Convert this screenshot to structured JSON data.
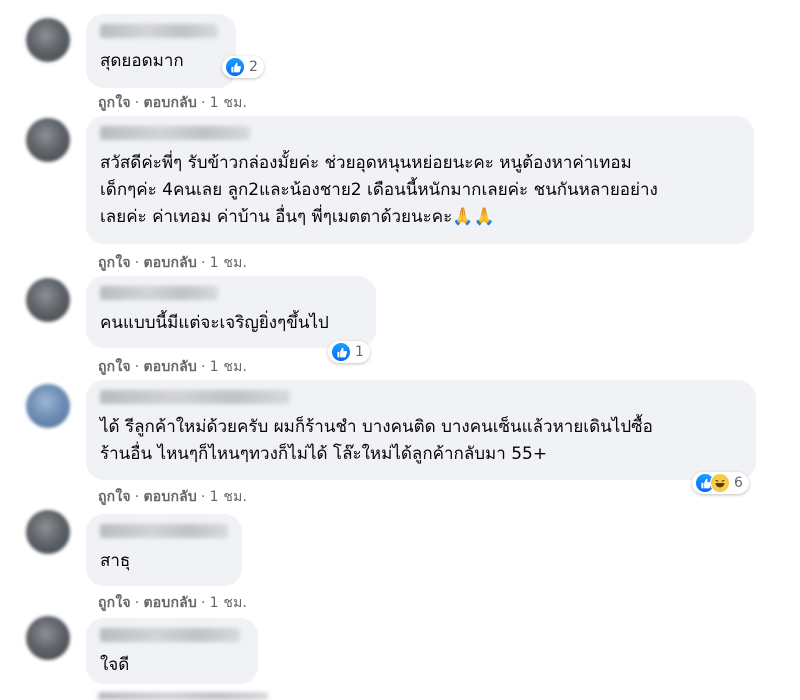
{
  "comments": [
    {
      "text": "สุดยอดมาก",
      "reactions": {
        "types": [
          "like"
        ],
        "count": "2"
      },
      "meta": {
        "like": "ถูกใจ",
        "reply": "ตอบกลับ",
        "time": "1 ชม."
      }
    },
    {
      "text": "สวัสดีค่ะพี่ๆ รับข้าวกล่องมั้ยค่ะ ช่วยอุดหนุนหย่อยนะคะ หนูต้องหาค่าเทอม\nเด็กๆค่ะ 4คนเลย ลูก2และน้องชาย2 เดือนนี้หนักมากเลยค่ะ ชนกันหลายอย่าง\nเลยค่ะ ค่าเทอม ค่าบ้าน อื่นๆ พี่ๆเมตตาด้วยนะคะ🙏🙏",
      "meta": {
        "like": "ถูกใจ",
        "reply": "ตอบกลับ",
        "time": "1 ชม."
      }
    },
    {
      "text": "คนแบบนี้มีแต่จะเจริญยิ่งๆขึ้นไป",
      "reactions": {
        "types": [
          "like"
        ],
        "count": "1"
      },
      "meta": {
        "like": "ถูกใจ",
        "reply": "ตอบกลับ",
        "time": "1 ชม."
      }
    },
    {
      "text": "ได้ รีลูกค้าใหม่ด้วยครับ ผมก็ร้านชำ บางคนติด บางคนเซ็นแล้วหายเดินไปซื้อ\nร้านอื่น ไหนๆก็ไหนๆทวงก็ไม่ได้ โล๊ะใหม่ได้ลูกค้ากลับมา 55+",
      "reactions": {
        "types": [
          "like",
          "haha"
        ],
        "count": "6"
      },
      "meta": {
        "like": "ถูกใจ",
        "reply": "ตอบกลับ",
        "time": "1 ชม."
      }
    },
    {
      "text": "สาธุ",
      "meta": {
        "like": "ถูกใจ",
        "reply": "ตอบกลับ",
        "time": "1 ชม."
      }
    },
    {
      "text": "ใจดี"
    }
  ],
  "colors": {
    "bubble": "#f0f2f5",
    "meta": "#65676b",
    "like": "#0866ff"
  },
  "icons": {
    "like": "thumbs-up-icon",
    "haha": "laughing-face-icon",
    "pray": "folded-hands-emoji"
  }
}
